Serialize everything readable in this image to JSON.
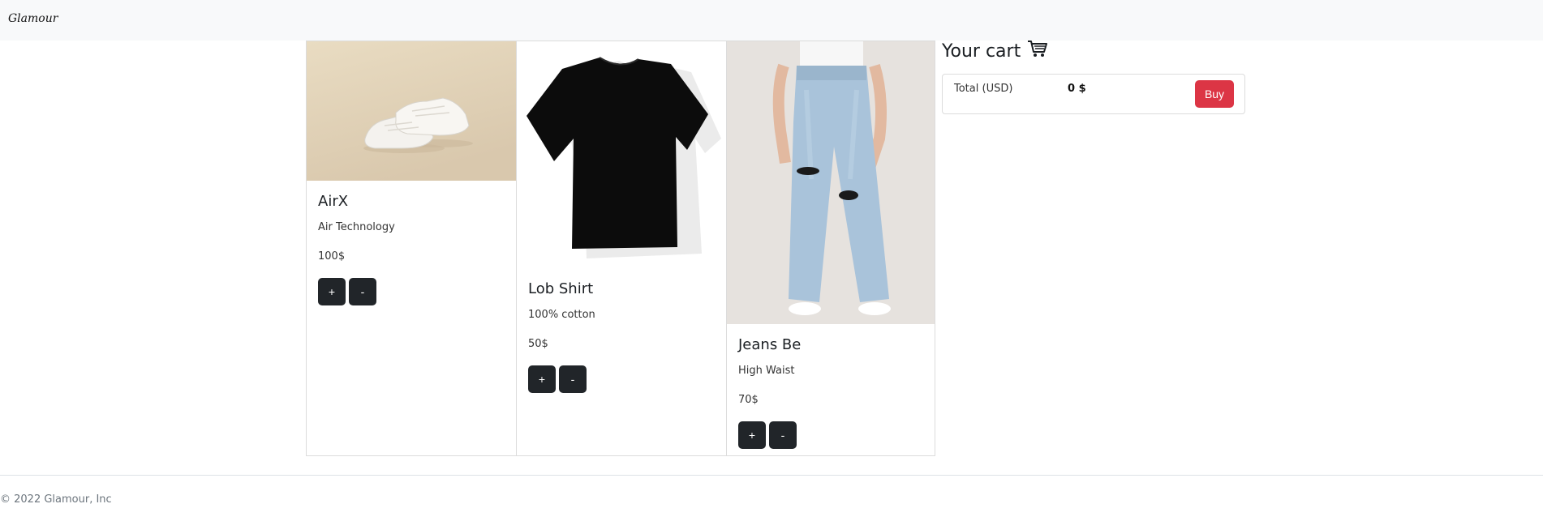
{
  "navbar": {
    "brand": "Glamour"
  },
  "products": [
    {
      "title": "AirX",
      "description": "Air Technology",
      "price": "100$",
      "plus_label": "+",
      "minus_label": "-"
    },
    {
      "title": "Lob Shirt",
      "description": "100% cotton",
      "price": "50$",
      "plus_label": "+",
      "minus_label": "-"
    },
    {
      "title": "Jeans Be",
      "description": "High Waist",
      "price": "70$",
      "plus_label": "+",
      "minus_label": "-"
    }
  ],
  "cart": {
    "title": "Your cart",
    "icon": "shopping-cart-icon",
    "total_label": "Total (USD)",
    "total_value": "0 $",
    "buy_label": "Buy"
  },
  "footer": {
    "copyright": "© 2022 Glamour, Inc"
  },
  "colors": {
    "buy": "#dc3545",
    "dark_button": "#212529",
    "navbar_bg": "#f8f9fa"
  }
}
